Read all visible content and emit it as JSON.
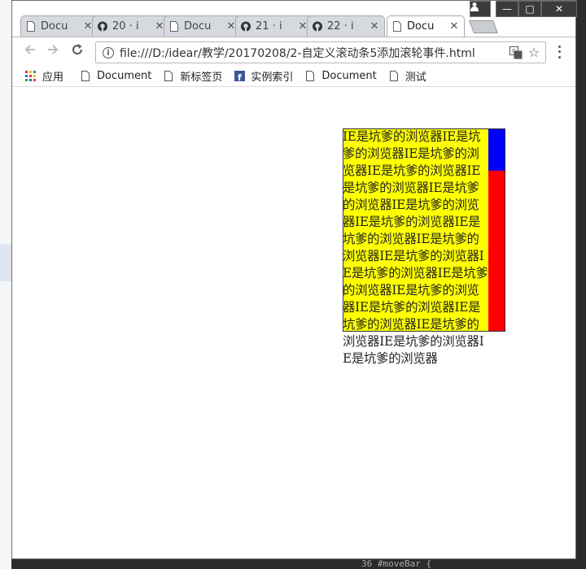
{
  "window": {
    "tabs": [
      {
        "label": "Docu",
        "icon": "page-icon",
        "active": false
      },
      {
        "label": "20 · i",
        "icon": "github-icon",
        "active": false
      },
      {
        "label": "Docu",
        "icon": "page-icon",
        "active": false
      },
      {
        "label": "21 · i",
        "icon": "github-icon",
        "active": false
      },
      {
        "label": "22 · i",
        "icon": "github-icon",
        "active": false
      },
      {
        "label": "Docu",
        "icon": "page-icon",
        "active": true
      }
    ]
  },
  "toolbar": {
    "url": "file:///D:/idear/教学/20170208/2-自定义滚动条5添加滚轮事件.html"
  },
  "bookmarks": [
    {
      "label": "应用",
      "icon": "apps-grid-icon"
    },
    {
      "label": "Document",
      "icon": "page-icon"
    },
    {
      "label": "新标签页",
      "icon": "page-icon"
    },
    {
      "label": "实例索引",
      "icon": "facebook-icon"
    },
    {
      "label": "Document",
      "icon": "page-icon"
    },
    {
      "label": "测试",
      "icon": "page-icon"
    }
  ],
  "content": {
    "text": "IE是坑爹的浏览器IE是坑爹的浏览器IE是坑爹的浏览器IE是坑爹的浏览器IE是坑爹的浏览器IE是坑爹的浏览器IE是坑爹的浏览器IE是坑爹的浏览器IE是坑爹的浏览器IE是坑爹的浏览器IE是坑爹的浏览器IE是坑爹的浏览器IE是坑爹的浏览器IE是坑爹的浏览器IE是坑爹的浏览器IE是坑爹的浏览器IE是坑爹的浏览器IE是坑爹的浏览器IE是坑爹的浏览器",
    "box_color": "#ffff00",
    "track_color": "#ff0000",
    "thumb_color": "#0000ff"
  },
  "background": {
    "code_fragment": "36        #moveBar {"
  }
}
